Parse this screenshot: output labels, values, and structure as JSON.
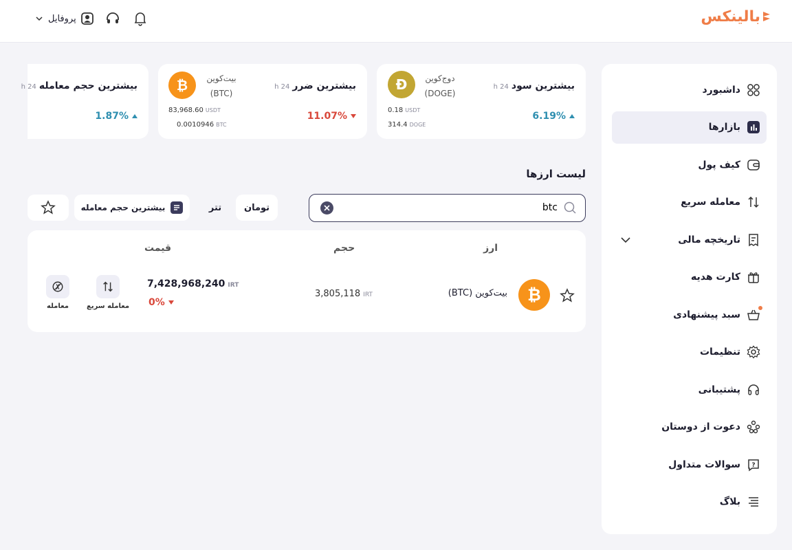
{
  "header": {
    "logo_text": "بالینکس",
    "profile_label": "پروفایل",
    "icons": [
      "bell-icon",
      "headset-icon",
      "user-icon",
      "chevron-down-icon"
    ]
  },
  "sidebar": {
    "items": [
      {
        "label": "داشبورد",
        "icon": "grid-icon"
      },
      {
        "label": "بازارها",
        "icon": "chart-icon",
        "active": true
      },
      {
        "label": "کیف پول",
        "icon": "wallet-icon"
      },
      {
        "label": "معامله سریع",
        "icon": "swap-icon"
      },
      {
        "label": "تاریخچه مالی",
        "icon": "receipt-icon"
      },
      {
        "label": "کارت هدیه",
        "icon": "gift-icon"
      },
      {
        "label": "سبد پیشنهادی",
        "icon": "basket-icon"
      },
      {
        "label": "تنظیمات",
        "icon": "gear-icon"
      },
      {
        "label": "پشتیبانی",
        "icon": "headset-icon"
      },
      {
        "label": "دعوت از دوستان",
        "icon": "people-icon"
      },
      {
        "label": "سوالات متداول",
        "icon": "question-icon"
      },
      {
        "label": "بلاگ",
        "icon": "lines-icon"
      }
    ]
  },
  "cards": {
    "top_gain": {
      "title": "بیشترین سود",
      "period": "24 h",
      "coin_name": "دوج‌کوین",
      "coin_symbol": "(DOGE)",
      "coin_glyph": "Ð",
      "price_usdt": "0.18",
      "unit_usdt": "USDT",
      "amount": "314.4",
      "unit_amount": "DOGE",
      "change": "6.19%"
    },
    "top_loss": {
      "title": "بیشترین ضرر",
      "period": "24 h",
      "coin_name": "بیت‌کوین",
      "coin_symbol": "(BTC)",
      "coin_glyph": "₿",
      "price_usdt": "83,968.60",
      "unit_usdt": "USDT",
      "amount": "0.0010946",
      "unit_amount": "BTC",
      "change": "11.07%"
    },
    "top_volume": {
      "title": "بیشترین حجم معامله",
      "period": "24 h",
      "change": "1.87%"
    }
  },
  "list": {
    "title": "لیست ارزها",
    "search_value": "btc",
    "tabs": {
      "toman": "تومان",
      "tether": "تتر"
    },
    "sort_label": "بیشترین حجم معامله",
    "headers": {
      "coin": "ارز",
      "volume": "حجم",
      "price": "قیمت"
    },
    "rows": [
      {
        "name": "بیت‌کوین (BTC)",
        "glyph": "₿",
        "volume": "3,805,118",
        "volume_unit": "IRT",
        "price": "7,428,968,240",
        "price_unit": "IRT",
        "change": "0%",
        "quick_trade": "معامله سریع",
        "trade": "معامله"
      }
    ]
  },
  "colors": {
    "accent": "#ef7d48",
    "up": "#2f8fb0",
    "down": "#d9483b",
    "btc": "#f7931a",
    "doge": "#c2a633"
  }
}
